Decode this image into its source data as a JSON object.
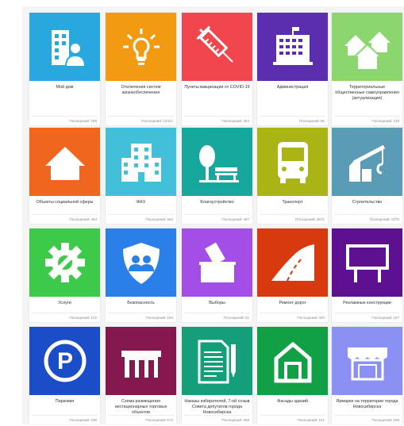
{
  "visits_label": "Посещений:",
  "cards": [
    {
      "title": "Мой дом",
      "visits": "785",
      "color": "#29a8e0",
      "icon": "building-person-icon"
    },
    {
      "title": "Отключения систем жизнеобеспечения",
      "visits": "13421",
      "color": "#f39a13",
      "icon": "light-bulb-icon"
    },
    {
      "title": "Пункты вакцинации от COVID-19",
      "visits": "454",
      "color": "#f1464d",
      "icon": "syringe-icon"
    },
    {
      "title": "Администрация",
      "visits": "65",
      "color": "#5b2eb0",
      "icon": "government-building-icon"
    },
    {
      "title": "Территориальные общественные самоуправления (актуализация)",
      "visits": "140",
      "color": "#8bd66f",
      "icon": "houses-icon"
    },
    {
      "title": "Объекты социальной сферы",
      "visits": "484",
      "color": "#f0661f",
      "icon": "home-icon"
    },
    {
      "title": "ЖКХ",
      "visits": "554",
      "color": "#42c0d9",
      "icon": "apartment-building-icon"
    },
    {
      "title": "Благоустройство",
      "visits": "407",
      "color": "#16a89c",
      "icon": "tree-bench-icon"
    },
    {
      "title": "Транспорт",
      "visits": "3572",
      "color": "#aab515",
      "icon": "bus-icon"
    },
    {
      "title": "Строительство",
      "visits": "1076",
      "color": "#5a9bb5",
      "icon": "crane-icon"
    },
    {
      "title": "Услуги",
      "visits": "122",
      "color": "#3dca4a",
      "icon": "gear-wrench-icon"
    },
    {
      "title": "Безопасность",
      "visits": "194",
      "color": "#2a7fe8",
      "icon": "shield-people-icon"
    },
    {
      "title": "Выборы",
      "visits": "31",
      "color": "#a34ee6",
      "icon": "ballot-box-icon"
    },
    {
      "title": "Ремонт дорог",
      "visits": "340",
      "color": "#d63a0e",
      "icon": "road-icon"
    },
    {
      "title": "Рекламные конструкции",
      "visits": "197",
      "color": "#5d1190",
      "icon": "billboard-icon"
    },
    {
      "title": "Парковки",
      "visits": "235",
      "color": "#1c4dc8",
      "icon": "parking-icon"
    },
    {
      "title": "Схема размещения нестационарных торговых объектов",
      "visits": "572",
      "color": "#85184e",
      "icon": "kiosk-icon"
    },
    {
      "title": "Наказы избирателей, 7-ой созыв Совета депутатов города Новосибирска",
      "visits": "258",
      "color": "#149e7a",
      "icon": "document-pen-icon"
    },
    {
      "title": "Фасады зданий",
      "visits": "101",
      "color": "#12a046",
      "icon": "facade-icon"
    },
    {
      "title": "Ярмарки на территории города Новосибирска",
      "visits": "209",
      "color": "#8b91f3",
      "icon": "market-stall-icon"
    }
  ]
}
